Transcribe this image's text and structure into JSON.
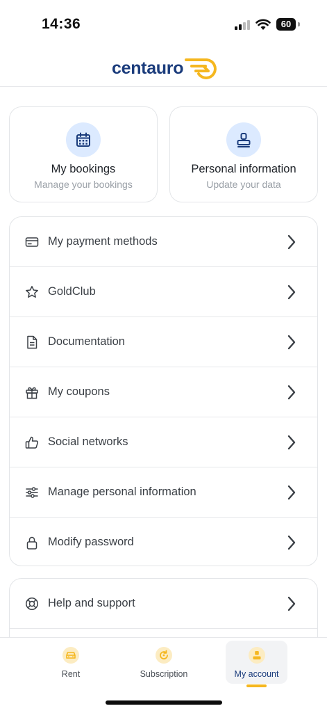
{
  "status_bar": {
    "time": "14:36",
    "battery": "60"
  },
  "header": {
    "logo_text": "centauro"
  },
  "cards": [
    {
      "title": "My bookings",
      "subtitle": "Manage your bookings",
      "icon": "calendar-icon"
    },
    {
      "title": "Personal information",
      "subtitle": "Update your data",
      "icon": "stamp-icon"
    }
  ],
  "menu": {
    "items": [
      {
        "label": "My payment methods",
        "icon": "credit-card-icon"
      },
      {
        "label": "GoldClub",
        "icon": "star-icon"
      },
      {
        "label": "Documentation",
        "icon": "document-icon"
      },
      {
        "label": "My coupons",
        "icon": "gift-icon"
      },
      {
        "label": "Social networks",
        "icon": "thumbs-up-icon"
      },
      {
        "label": "Manage personal information",
        "icon": "sliders-icon"
      },
      {
        "label": "Modify password",
        "icon": "lock-icon"
      }
    ],
    "help": [
      {
        "label": "Help and support",
        "icon": "lifebuoy-icon"
      }
    ]
  },
  "bottom_nav": {
    "items": [
      {
        "label": "Rent",
        "icon": "car-icon"
      },
      {
        "label": "Subscription",
        "icon": "subscription-icon"
      },
      {
        "label": "My account",
        "icon": "user-icon",
        "active": true
      }
    ]
  },
  "colors": {
    "brand": "#1b3c7c",
    "accent": "#f5b71f",
    "icon_bg": "#dceaff"
  }
}
